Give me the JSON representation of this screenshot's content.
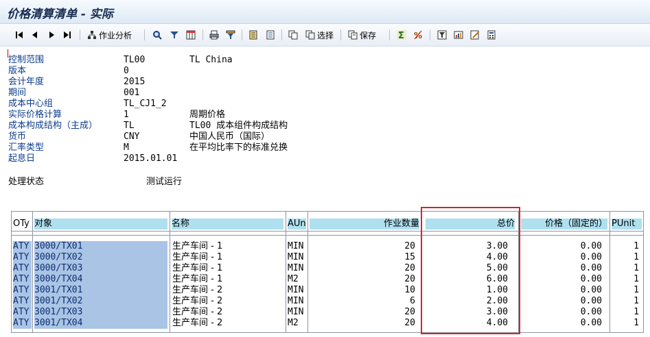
{
  "window": {
    "title": "价格清算清单 - 实际"
  },
  "toolbar": {
    "activity_analysis": "作业分析",
    "select": "选择",
    "save": "保存"
  },
  "header_fields": [
    {
      "label": "控制范围",
      "value": "TL00",
      "desc": "TL China"
    },
    {
      "label": "版本",
      "value": "0",
      "desc": ""
    },
    {
      "label": "会计年度",
      "value": "2015",
      "desc": ""
    },
    {
      "label": "期间",
      "value": "001",
      "desc": ""
    },
    {
      "label": "成本中心组",
      "value": "TL_CJ1_2",
      "desc": ""
    },
    {
      "label": "实际价格计算",
      "value": "1",
      "desc": "周期价格"
    },
    {
      "label": "成本构成结构（主成）",
      "value": "TL",
      "desc": "TL00 成本组件构成结构"
    },
    {
      "label": "货币",
      "value": "CNY",
      "desc": "中国人民币（国际）"
    },
    {
      "label": "汇率类型",
      "value": "M",
      "desc": "在平均比率下的标准兑换"
    },
    {
      "label": "起息日",
      "value": "2015.01.01",
      "desc": ""
    }
  ],
  "status": {
    "label": "处理状态",
    "value": "测试运行"
  },
  "table": {
    "columns": [
      "OTy",
      "对象",
      "名称",
      "AUn",
      "作业数量",
      "总价",
      "价格（固定的）",
      "PUnit"
    ],
    "rows": [
      {
        "oty": "ATY",
        "object": "3000/TX01",
        "name": "生产车间 - 1",
        "aun": "MIN",
        "qty": "20",
        "total": "3.00",
        "fixed": "0.00",
        "punit": "1"
      },
      {
        "oty": "ATY",
        "object": "3000/TX02",
        "name": "生产车间 - 1",
        "aun": "MIN",
        "qty": "15",
        "total": "4.00",
        "fixed": "0.00",
        "punit": "1"
      },
      {
        "oty": "ATY",
        "object": "3000/TX03",
        "name": "生产车间 - 1",
        "aun": "MIN",
        "qty": "20",
        "total": "5.00",
        "fixed": "0.00",
        "punit": "1"
      },
      {
        "oty": "ATY",
        "object": "3000/TX04",
        "name": "生产车间 - 1",
        "aun": "M2",
        "qty": "20",
        "total": "6.00",
        "fixed": "0.00",
        "punit": "1"
      },
      {
        "oty": "ATY",
        "object": "3001/TX01",
        "name": "生产车间 - 2",
        "aun": "MIN",
        "qty": "10",
        "total": "1.00",
        "fixed": "0.00",
        "punit": "1"
      },
      {
        "oty": "ATY",
        "object": "3001/TX02",
        "name": "生产车间 - 2",
        "aun": "MIN",
        "qty": "6",
        "total": "2.00",
        "fixed": "0.00",
        "punit": "1"
      },
      {
        "oty": "ATY",
        "object": "3001/TX03",
        "name": "生产车间 - 2",
        "aun": "MIN",
        "qty": "20",
        "total": "3.00",
        "fixed": "0.00",
        "punit": "1"
      },
      {
        "oty": "ATY",
        "object": "3001/TX04",
        "name": "生产车间 - 2",
        "aun": "M2",
        "qty": "20",
        "total": "4.00",
        "fixed": "0.00",
        "punit": "1"
      }
    ]
  },
  "colors": {
    "highlight_box": "#e02020",
    "selection": "#aac4e6",
    "column_header": "#aee0f0"
  }
}
